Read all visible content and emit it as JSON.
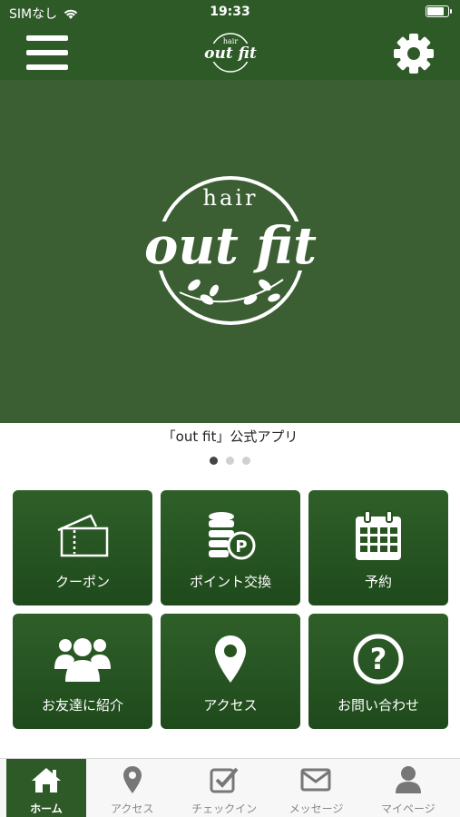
{
  "status": {
    "carrier": "SIMなし",
    "time": "19:33"
  },
  "header": {
    "logo_top": "hair",
    "logo_main": "out fit"
  },
  "hero": {
    "logo_top": "hair",
    "logo_main": "out fit"
  },
  "caption": "「out fit」公式アプリ",
  "slider": {
    "count": 3,
    "active": 1
  },
  "menu_tiles": [
    {
      "label": "クーポン",
      "icon": "ticket-icon"
    },
    {
      "label": "ポイント交換",
      "icon": "points-exchange-icon"
    },
    {
      "label": "予約",
      "icon": "calendar-icon"
    },
    {
      "label": "お友達に紹介",
      "icon": "people-icon"
    },
    {
      "label": "アクセス",
      "icon": "map-pin-icon"
    },
    {
      "label": "お問い合わせ",
      "icon": "question-icon"
    }
  ],
  "tabs": [
    {
      "label": "ホーム",
      "icon": "home-icon",
      "active": true
    },
    {
      "label": "アクセス",
      "icon": "map-pin-icon"
    },
    {
      "label": "チェックイン",
      "icon": "checkin-icon"
    },
    {
      "label": "メッセージ",
      "icon": "mail-icon"
    },
    {
      "label": "マイページ",
      "icon": "user-icon"
    }
  ],
  "colors": {
    "primary": "#2e5a27",
    "hero": "#3b5e32",
    "tab_inactive": "#888888"
  }
}
